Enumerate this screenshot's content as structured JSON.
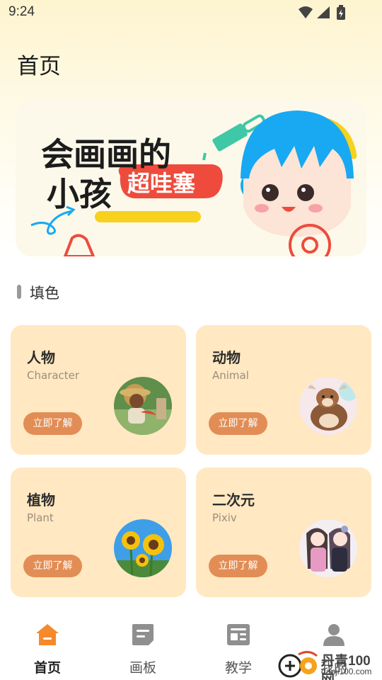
{
  "status_bar": {
    "time": "9:24",
    "icons": [
      "wifi-icon",
      "signal-icon",
      "battery-charging-icon"
    ]
  },
  "header": {
    "title": "首页"
  },
  "banner": {
    "line1": "会画画的",
    "line2": "小孩",
    "tag": "超哇塞",
    "colors": {
      "blue": "#18a9f2",
      "red": "#ee4b3c",
      "yellow": "#f7d11e",
      "green": "#3fc8a5"
    }
  },
  "section": {
    "title": "填色"
  },
  "cards": [
    {
      "title": "人物",
      "subtitle": "Character",
      "button": "立即了解",
      "thumb": "girl-with-watermelon-image"
    },
    {
      "title": "动物",
      "subtitle": "Animal",
      "button": "立即了解",
      "thumb": "cartoon-goat-image"
    },
    {
      "title": "植物",
      "subtitle": "Plant",
      "button": "立即了解",
      "thumb": "sunflowers-image"
    },
    {
      "title": "二次元",
      "subtitle": "Pixiv",
      "button": "立即了解",
      "thumb": "anime-girls-image"
    }
  ],
  "tabs": [
    {
      "label": "首页",
      "icon": "home-icon",
      "active": true
    },
    {
      "label": "画板",
      "icon": "canvas-icon",
      "active": false
    },
    {
      "label": "教学",
      "icon": "tutorial-icon",
      "active": false
    },
    {
      "label": "我的",
      "icon": "profile-icon",
      "active": false
    }
  ],
  "watermark": {
    "name": "丹青100网",
    "url": "danji100.com"
  },
  "colors": {
    "card_bg": "#ffe8c2",
    "button": "#e28d55",
    "accent_orange": "#f58a2c",
    "tab_grey": "#8f8f8f"
  }
}
